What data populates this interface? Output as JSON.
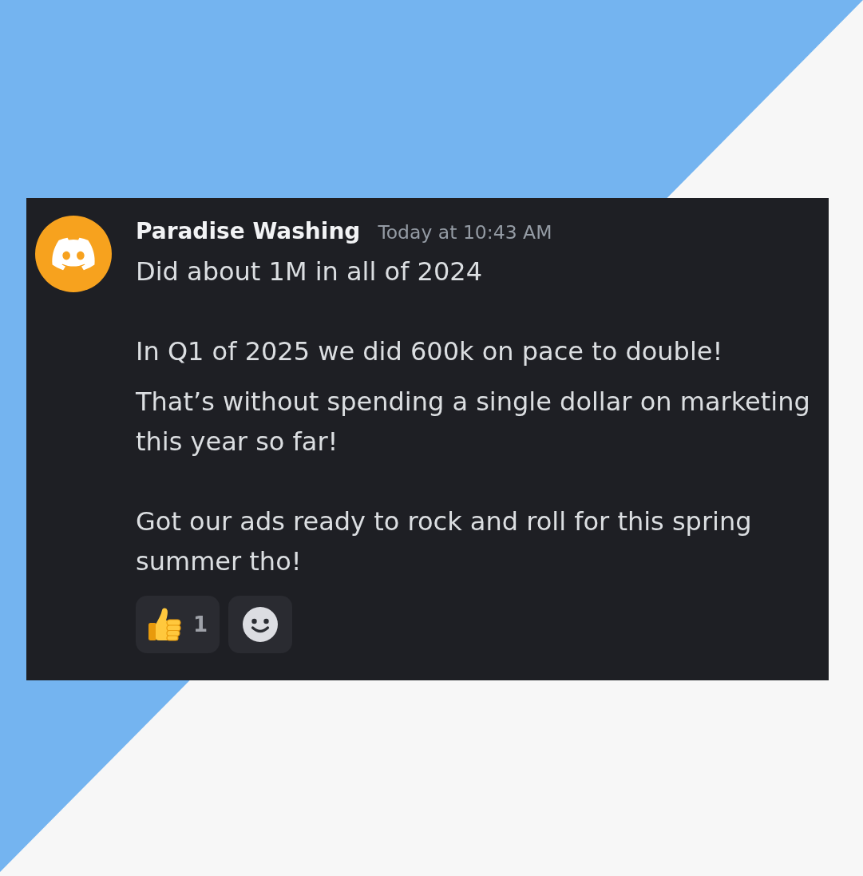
{
  "message": {
    "author": "Paradise Washing",
    "timestamp": "Today at 10:43 AM",
    "groups": [
      [
        "Did about 1M in all of 2024"
      ],
      [
        "In Q1 of 2025 we did 600k on pace to double!",
        "That’s without spending a single dollar on marketing this year so far!"
      ],
      [
        "Got our ads ready to rock and roll for this spring summer tho!"
      ]
    ],
    "reactions": [
      {
        "kind": "emoji",
        "count": "1"
      },
      {
        "kind": "add"
      }
    ]
  }
}
